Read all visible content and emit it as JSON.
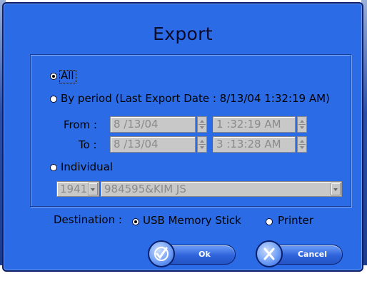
{
  "dialog": {
    "title": "Export",
    "options": {
      "all_label": "All",
      "by_period_label": "By period (Last Export Date : 8/13/04 1:32:19 AM)",
      "individual_label": "Individual",
      "selected": "All"
    },
    "period": {
      "from_label": "From :",
      "to_label": "To :",
      "from_date": "8 /13/04",
      "from_time": "1 :32:19 AM",
      "to_date": "8 /13/04",
      "to_time": "3 :13:28 AM"
    },
    "individual": {
      "code_value": "1941",
      "person_value": "984595&KIM JS"
    },
    "destination": {
      "label": "Destination :",
      "usb_label": "USB Memory Stick",
      "printer_label": "Printer",
      "selected": "USB Memory Stick"
    },
    "buttons": {
      "ok_label": "Ok",
      "cancel_label": "Cancel"
    }
  },
  "colors": {
    "dialog_bg": "#2b6ce6",
    "dialog_border": "#0b1e6b",
    "disabled_field": "#c8c8c8",
    "button_fill": "#2e63db"
  },
  "icons": {
    "ok": "check-circle-icon",
    "cancel": "x-circle-icon",
    "spinner": "spinner-arrows-icon",
    "dropdown": "chevron-down-icon"
  }
}
